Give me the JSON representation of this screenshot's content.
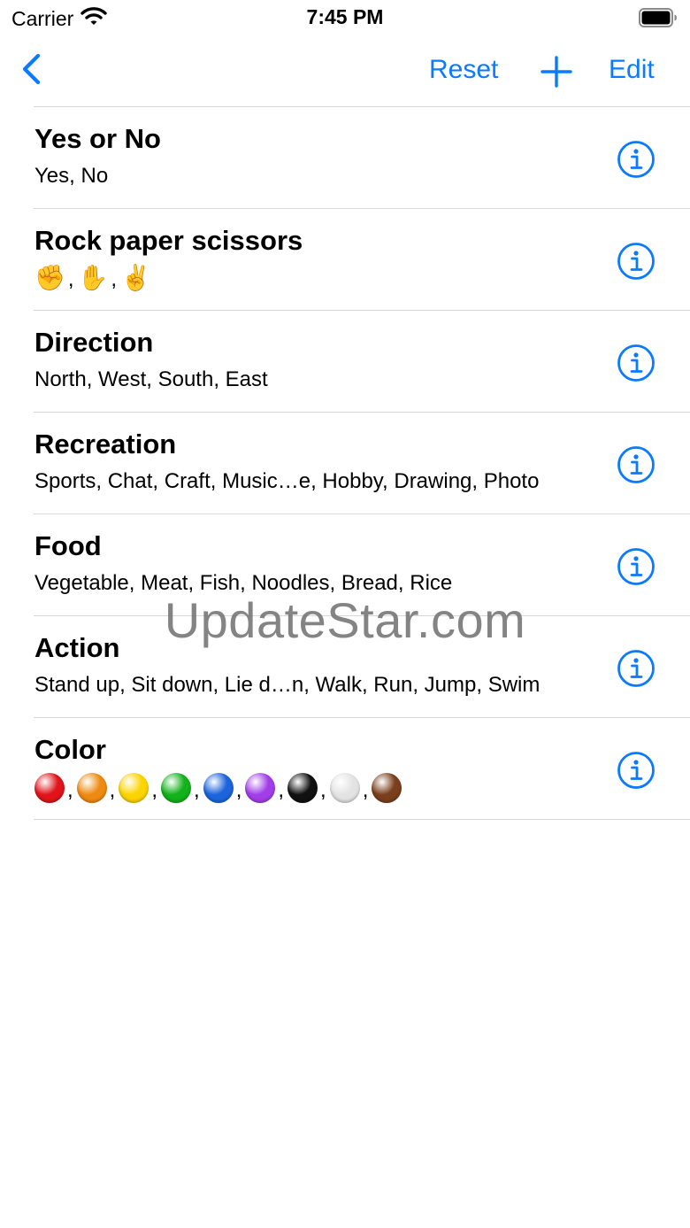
{
  "status_bar": {
    "carrier": "Carrier",
    "time": "7:45 PM"
  },
  "nav": {
    "reset_label": "Reset",
    "edit_label": "Edit"
  },
  "rows": [
    {
      "title": "Yes or No",
      "subtitle": "Yes, No"
    },
    {
      "title": "Rock paper scissors",
      "emojis": [
        "✊",
        "✋",
        "✌️"
      ]
    },
    {
      "title": "Direction",
      "subtitle": "North, West, South, East"
    },
    {
      "title": "Recreation",
      "subtitle": "Sports, Chat, Craft, Music…e, Hobby, Drawing, Photo"
    },
    {
      "title": "Food",
      "subtitle": "Vegetable, Meat, Fish, Noodles, Bread, Rice"
    },
    {
      "title": "Action",
      "subtitle": "Stand up, Sit down, Lie d…n, Walk, Run, Jump, Swim"
    },
    {
      "title": "Color",
      "circles": [
        "red",
        "orange",
        "yellow",
        "green",
        "blue",
        "purple",
        "black",
        "white",
        "brown"
      ]
    }
  ],
  "colors": {
    "accent": "#0A7AFF",
    "red": "#E0141A",
    "orange": "#EE8A12",
    "yellow": "#FCD400",
    "green": "#12B21A",
    "blue": "#1C64DC",
    "purple": "#A13EE8",
    "black": "#111111",
    "white": "#E3E3E3",
    "brown": "#7A3F1C"
  },
  "watermark": "UpdateStar.com"
}
